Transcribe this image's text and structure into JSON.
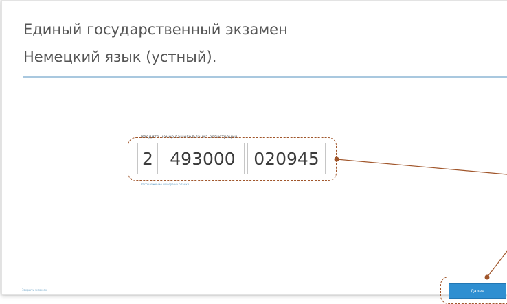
{
  "header": {
    "title_line1": "Единый государственный экзамен",
    "title_line2": "Немецкий язык (устный)."
  },
  "registration": {
    "label": "Введите номер вашего бланка регистрации",
    "fields": [
      "2",
      "493000",
      "020945"
    ],
    "hint": "Расположение номера на бланке"
  },
  "footer": {
    "close_link": "Закрыть экзамен",
    "next_button": "Далее"
  },
  "colors": {
    "accent": "#2f8fd1",
    "rule": "#a9c8df",
    "callout": "#a0552a"
  }
}
